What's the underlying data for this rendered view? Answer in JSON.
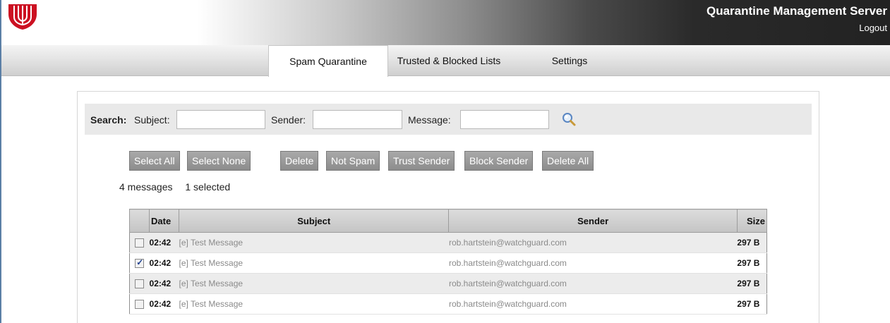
{
  "header": {
    "app_title": "Quarantine Management Server",
    "logout_label": "Logout",
    "logo_icon": "watchguard-shield-logo",
    "brand_color": "#cc1122"
  },
  "tabs": [
    {
      "label": "Spam Quarantine",
      "active": true
    },
    {
      "label": "Trusted & Blocked Lists",
      "active": false
    },
    {
      "label": "Settings",
      "active": false
    }
  ],
  "search": {
    "label": "Search:",
    "subject_label": "Subject:",
    "subject_value": "",
    "sender_label": "Sender:",
    "sender_value": "",
    "message_label": "Message:",
    "message_value": "",
    "button_icon": "magnifier-icon"
  },
  "buttons": {
    "select_all": "Select All",
    "select_none": "Select None",
    "delete": "Delete",
    "not_spam": "Not Spam",
    "trust_sender": "Trust Sender",
    "block_sender": "Block Sender",
    "delete_all": "Delete All"
  },
  "counts": {
    "messages": "4 messages",
    "selected": "1 selected"
  },
  "table": {
    "columns": [
      "",
      "Date",
      "Subject",
      "Sender",
      "Size"
    ],
    "rows": [
      {
        "checked": false,
        "date": "02:42",
        "subject": "[e] Test Message",
        "sender": "rob.hartstein@watchguard.com",
        "size": "297 B"
      },
      {
        "checked": true,
        "date": "02:42",
        "subject": "[e] Test Message",
        "sender": "rob.hartstein@watchguard.com",
        "size": "297 B"
      },
      {
        "checked": false,
        "date": "02:42",
        "subject": "[e] Test Message",
        "sender": "rob.hartstein@watchguard.com",
        "size": "297 B"
      },
      {
        "checked": false,
        "date": "02:42",
        "subject": "[e] Test Message",
        "sender": "rob.hartstein@watchguard.com",
        "size": "297 B"
      }
    ]
  }
}
